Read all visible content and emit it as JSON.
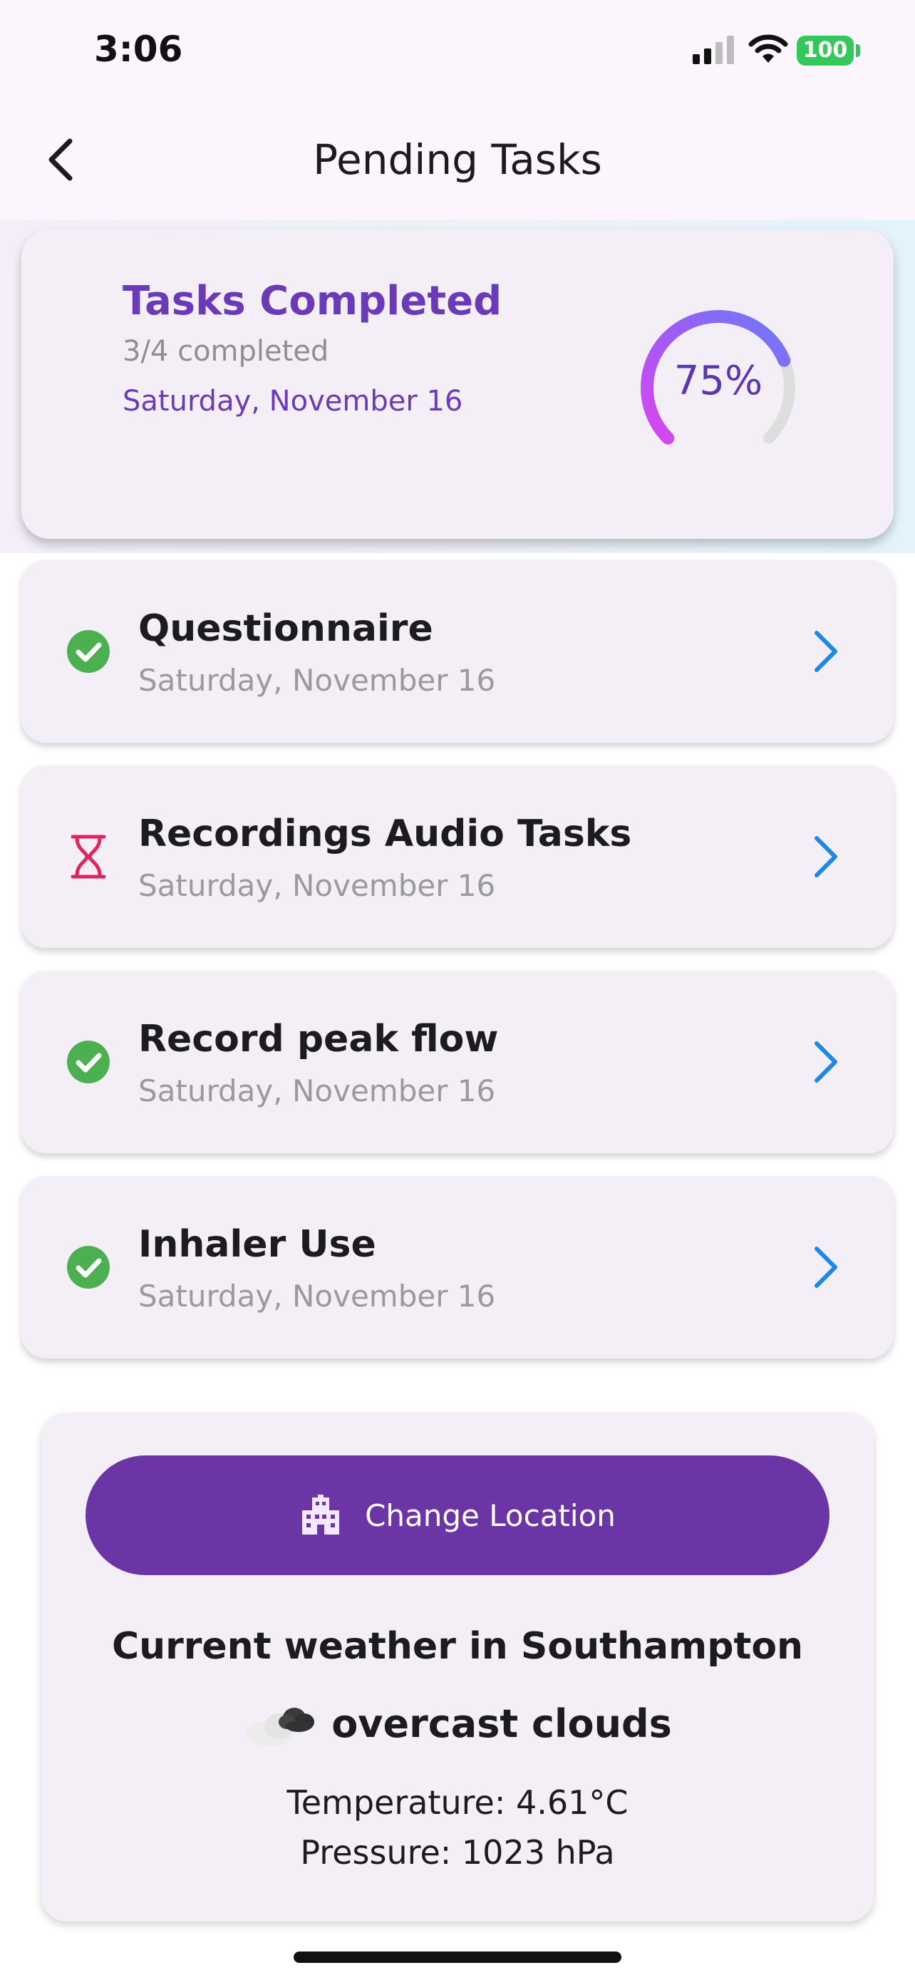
{
  "status_bar": {
    "time": "3:06",
    "battery": "100"
  },
  "header": {
    "title": "Pending Tasks"
  },
  "summary": {
    "title": "Tasks Completed",
    "count_text": "3/4 completed",
    "date": "Saturday, November 16",
    "progress_label": "75%",
    "progress": 0.75
  },
  "tasks": [
    {
      "title": "Questionnaire",
      "date": "Saturday, November 16",
      "status": "completed",
      "icon": "check-circle-icon"
    },
    {
      "title": "Recordings Audio Tasks",
      "date": "Saturday, November 16",
      "status": "pending",
      "icon": "hourglass-icon"
    },
    {
      "title": "Record peak flow",
      "date": "Saturday, November 16",
      "status": "completed",
      "icon": "check-circle-icon"
    },
    {
      "title": "Inhaler Use",
      "date": "Saturday, November 16",
      "status": "completed",
      "icon": "check-circle-icon"
    }
  ],
  "weather": {
    "button_label": "Change Location",
    "heading": "Current weather in Southampton",
    "description": "overcast clouds",
    "temperature": "Temperature: 4.61°C",
    "pressure": "Pressure: 1023 hPa"
  },
  "colors": {
    "accent": "#6c35a6",
    "title_purple": "#6a3ab8",
    "completed_green": "#4caf50",
    "pending_red": "#e0245e",
    "chevron_blue": "#1e88e5"
  }
}
